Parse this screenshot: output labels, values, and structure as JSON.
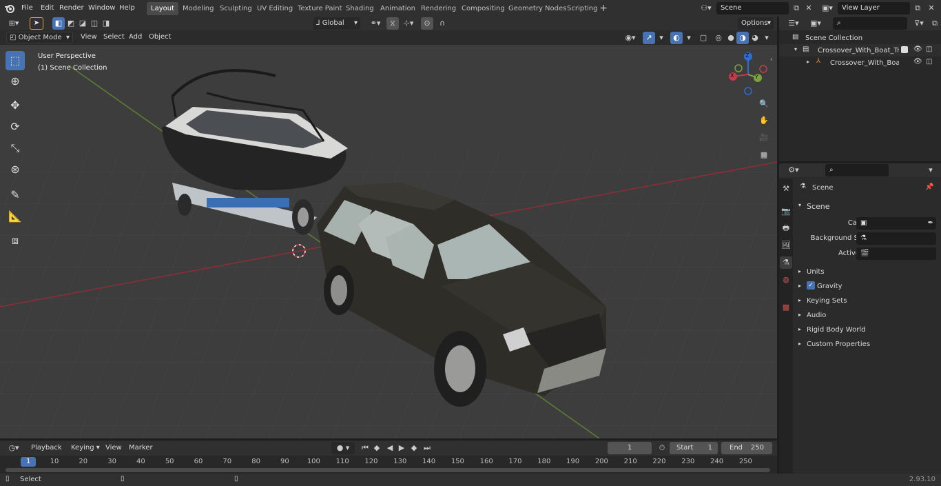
{
  "menu": {
    "file": "File",
    "edit": "Edit",
    "render": "Render",
    "window": "Window",
    "help": "Help"
  },
  "workspaces": [
    "Layout",
    "Modeling",
    "Sculpting",
    "UV Editing",
    "Texture Paint",
    "Shading",
    "Animation",
    "Rendering",
    "Compositing",
    "Geometry Nodes",
    "Scripting"
  ],
  "active_workspace": "Layout",
  "scene_field": "Scene",
  "view_layer_field": "View Layer",
  "viewport": {
    "mode": "Object Mode",
    "view": "View",
    "select": "Select",
    "add": "Add",
    "object": "Object",
    "transform": "Global",
    "options": "Options",
    "overlay_title": "User Perspective",
    "overlay_sub": "(1) Scene Collection"
  },
  "gizmo": {
    "x": "X",
    "y": "Y",
    "z": "Z"
  },
  "outliner": {
    "root": "Scene Collection",
    "collection": "Crossover_With_Boat_Trailer",
    "object": "Crossover_With_Boat_Tr"
  },
  "properties": {
    "header": "Scene",
    "panel": "Scene",
    "camera_label": "Camera",
    "bg_label": "Background Scene",
    "clip_label": "Active Clip",
    "sections": [
      "Units",
      "Gravity",
      "Keying Sets",
      "Audio",
      "Rigid Body World",
      "Custom Properties"
    ],
    "gravity_checked": true
  },
  "timeline": {
    "playback": "Playback",
    "keying": "Keying",
    "view": "View",
    "marker": "Marker",
    "current_frame": "1",
    "start_label": "Start",
    "start": "1",
    "end_label": "End",
    "end": "250",
    "ruler": [
      "1",
      "10",
      "20",
      "30",
      "40",
      "50",
      "60",
      "70",
      "80",
      "90",
      "100",
      "110",
      "120",
      "130",
      "140",
      "150",
      "160",
      "170",
      "180",
      "190",
      "200",
      "210",
      "220",
      "230",
      "240",
      "250"
    ]
  },
  "status": {
    "select": "Select",
    "version": "2.93.10"
  },
  "colors": {
    "accent": "#4772b3",
    "axis_x": "#c43c4a",
    "axis_y": "#7ba13e",
    "axis_z": "#2c6ed5",
    "bg": "#3d3d3d"
  }
}
